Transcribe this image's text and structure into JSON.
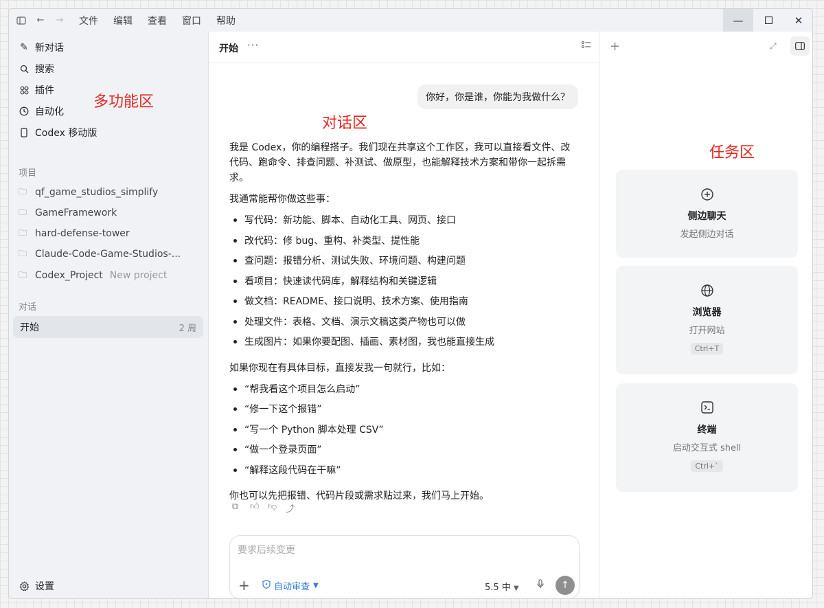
{
  "menu": [
    "文件",
    "编辑",
    "查看",
    "窗口",
    "帮助"
  ],
  "sidebar": {
    "nav": [
      {
        "icon": "edit-icon",
        "glyph": "✎",
        "label": "新对话"
      },
      {
        "icon": "search-icon",
        "glyph": "⚲",
        "label": "搜索"
      },
      {
        "icon": "grid-icon",
        "glyph": "⚏",
        "label": "插件"
      },
      {
        "icon": "clock-icon",
        "glyph": "◷",
        "label": "自动化"
      },
      {
        "icon": "phone-icon",
        "glyph": "▯",
        "label": "Codex 移动版"
      }
    ],
    "projects_title": "项目",
    "projects": [
      {
        "name": "qf_game_studios_simplify",
        "sub": ""
      },
      {
        "name": "GameFramework",
        "sub": ""
      },
      {
        "name": "hard-defense-tower",
        "sub": ""
      },
      {
        "name": "Claude-Code-Game-Studios-...",
        "sub": ""
      },
      {
        "name": "Codex_Project",
        "sub": "New project"
      }
    ],
    "conversations_title": "对话",
    "conversation": {
      "name": "开始",
      "age": "2 周"
    },
    "settings_label": "设置",
    "annotation": "多功能区"
  },
  "chat": {
    "title": "开始",
    "annotation": "对话区",
    "user_message": "你好，你是谁，你能为我做什么？",
    "answer": {
      "intro": "我是 Codex，你的编程搭子。我们现在共享这个工作区，我可以直接看文件、改代码、跑命令、排查问题、补测试、做原型，也能解释技术方案和带你一起拆需求。",
      "lead": "我通常能帮你做这些事：",
      "items": [
        "写代码：新功能、脚本、自动化工具、网页、接口",
        "改代码：修 bug、重构、补类型、提性能",
        "查问题：报错分析、测试失败、环境问题、构建问题",
        "看项目：快速读代码库，解释结构和关键逻辑",
        "做文档：README、接口说明、技术方案、使用指南",
        "处理文件：表格、文档、演示文稿这类产物也可以做",
        "生成图片：如果你要配图、插画、素材图，我也能直接生成"
      ],
      "lead2": "如果你现在有具体目标，直接发我一句就行，比如：",
      "examples": [
        "“帮我看这个项目怎么启动”",
        "“修一下这个报错”",
        "“写一个 Python 脚本处理 CSV”",
        "“做一个登录页面”",
        "“解释这段代码在干嘛”"
      ],
      "outro": "你也可以先把报错、代码片段或需求贴过来，我们马上开始。"
    },
    "composer": {
      "placeholder": "要求后续变更",
      "mode_label": "自动审查",
      "model_label": "5.5  中"
    }
  },
  "tasks": {
    "annotation": "任务区",
    "cards": [
      {
        "icon": "chat-plus-icon",
        "glyph": "⊕",
        "title": "侧边聊天",
        "subtitle": "发起侧边对话",
        "shortcut": ""
      },
      {
        "icon": "globe-icon",
        "glyph": "◍",
        "title": "浏览器",
        "subtitle": "打开网站",
        "shortcut": "Ctrl+T"
      },
      {
        "icon": "terminal-icon",
        "glyph": "⌸",
        "title": "终端",
        "subtitle": "启动交互式 shell",
        "shortcut": "Ctrl+`"
      }
    ]
  },
  "colors": {
    "annotation_red": "#e8241e",
    "accent_blue": "#2f7dd8"
  }
}
